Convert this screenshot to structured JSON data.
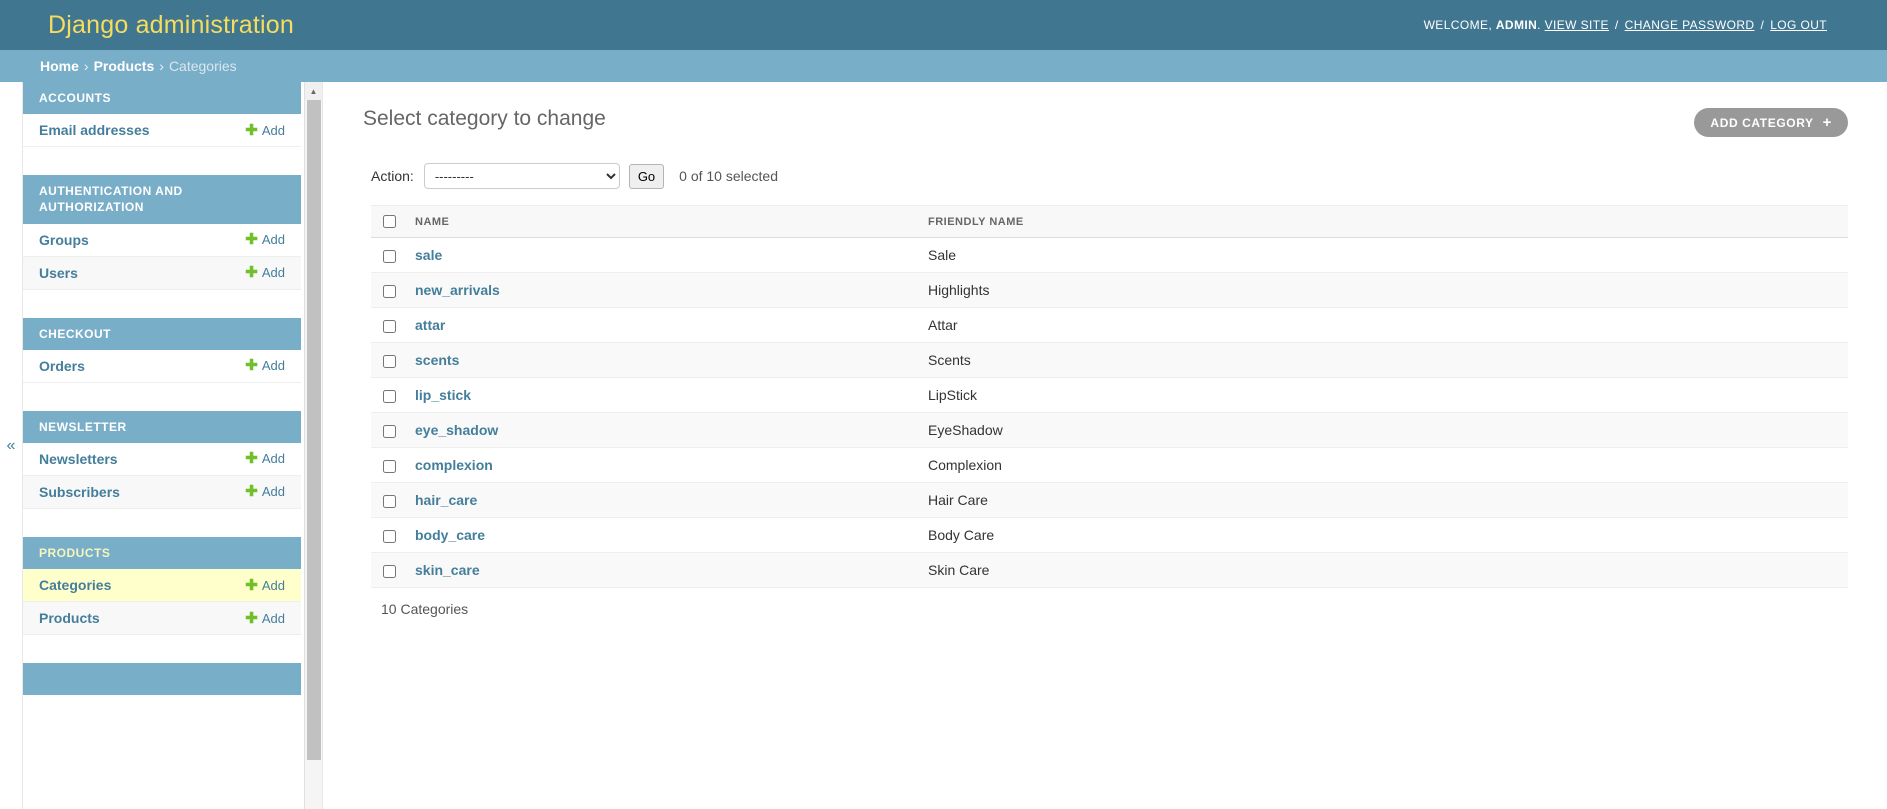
{
  "header": {
    "site_name": "Django administration",
    "welcome_prefix": "WELCOME,",
    "username": "ADMIN",
    "username_suffix": ".",
    "view_site": "VIEW SITE",
    "change_password": "CHANGE PASSWORD",
    "log_out": "LOG OUT",
    "separator": "/"
  },
  "breadcrumbs": {
    "home": "Home",
    "sep": "›",
    "products": "Products",
    "current": "Categories"
  },
  "sidebar": {
    "toggle_icon": "«",
    "add_label": "Add",
    "apps": [
      {
        "caption": "ACCOUNTS",
        "current": false,
        "models": [
          {
            "label": "Email addresses",
            "add": "Add",
            "selected": false
          }
        ]
      },
      {
        "caption": "AUTHENTICATION AND AUTHORIZATION",
        "current": false,
        "models": [
          {
            "label": "Groups",
            "add": "Add",
            "selected": false
          },
          {
            "label": "Users",
            "add": "Add",
            "selected": false
          }
        ]
      },
      {
        "caption": "CHECKOUT",
        "current": false,
        "models": [
          {
            "label": "Orders",
            "add": "Add",
            "selected": false
          }
        ]
      },
      {
        "caption": "NEWSLETTER",
        "current": false,
        "models": [
          {
            "label": "Newsletters",
            "add": "Add",
            "selected": false
          },
          {
            "label": "Subscribers",
            "add": "Add",
            "selected": false
          }
        ]
      },
      {
        "caption": "PRODUCTS",
        "current": true,
        "models": [
          {
            "label": "Categories",
            "add": "Add",
            "selected": true
          },
          {
            "label": "Products",
            "add": "Add",
            "selected": false
          }
        ]
      }
    ]
  },
  "main": {
    "page_title": "Select category to change",
    "add_button_label": "ADD CATEGORY",
    "add_button_icon": "+",
    "action_label": "Action:",
    "action_selected": "---------",
    "action_options": [
      "---------"
    ],
    "go_label": "Go",
    "action_counter": "0 of 10 selected",
    "columns": [
      "NAME",
      "FRIENDLY NAME"
    ],
    "rows": [
      {
        "name": "sale",
        "friendly": "Sale"
      },
      {
        "name": "new_arrivals",
        "friendly": "Highlights"
      },
      {
        "name": "attar",
        "friendly": "Attar"
      },
      {
        "name": "scents",
        "friendly": "Scents"
      },
      {
        "name": "lip_stick",
        "friendly": "LipStick"
      },
      {
        "name": "eye_shadow",
        "friendly": "EyeShadow"
      },
      {
        "name": "complexion",
        "friendly": "Complexion"
      },
      {
        "name": "hair_care",
        "friendly": "Hair Care"
      },
      {
        "name": "body_care",
        "friendly": "Body Care"
      },
      {
        "name": "skin_care",
        "friendly": "Skin Care"
      }
    ],
    "paginator_text": "10 Categories"
  },
  "colors": {
    "header_bg": "#417690",
    "breadcrumb_bg": "#79aec8",
    "accent_yellow": "#f5dd5d",
    "link_blue": "#447e9b",
    "plus_green": "#70bf2b",
    "selected_row": "#ffffcc",
    "button_grey": "#999999"
  }
}
